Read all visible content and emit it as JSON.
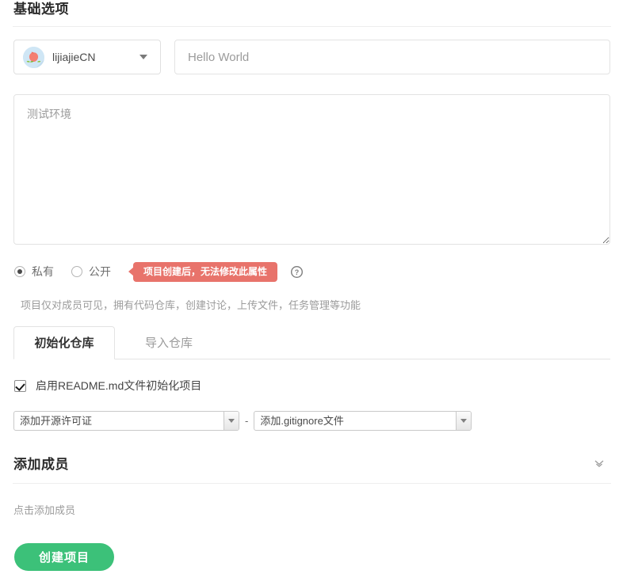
{
  "basic": {
    "section_title": "基础选项",
    "owner": {
      "name": "lijiajieCN",
      "avatar_icon": "peach-avatar-icon",
      "caret_icon": "caret-down-icon"
    },
    "project_name": {
      "value": "",
      "placeholder": "Hello World"
    },
    "description": {
      "value": "",
      "placeholder": "测试环境"
    },
    "visibility": {
      "private_label": "私有",
      "public_label": "公开",
      "selected": "私有",
      "notice_badge": "项目创建后，无法修改此属性",
      "help_icon": "help-circle-icon",
      "hint": "项目仅对成员可见，拥有代码仓库，创建讨论，上传文件，任务管理等功能"
    },
    "tabs": [
      {
        "label": "初始化仓库",
        "active": true
      },
      {
        "label": "导入仓库",
        "active": false
      }
    ],
    "readme": {
      "label": "启用README.md文件初始化项目",
      "checked": true
    },
    "license_select": {
      "value": "添加开源许可证",
      "caret_icon": "caret-down-icon"
    },
    "separator": "-",
    "gitignore_select": {
      "value": "添加.gitignore文件",
      "caret_icon": "caret-down-icon"
    }
  },
  "members": {
    "section_title": "添加成员",
    "collapse_icon": "chevron-double-down-icon",
    "placeholder": "点击添加成员"
  },
  "footer": {
    "create_button": "创建项目"
  },
  "colors": {
    "accent_green": "#3cc179",
    "notice_red": "#e8736b",
    "border_gray": "#e3e3e3",
    "muted_text": "#9b9b9b"
  }
}
